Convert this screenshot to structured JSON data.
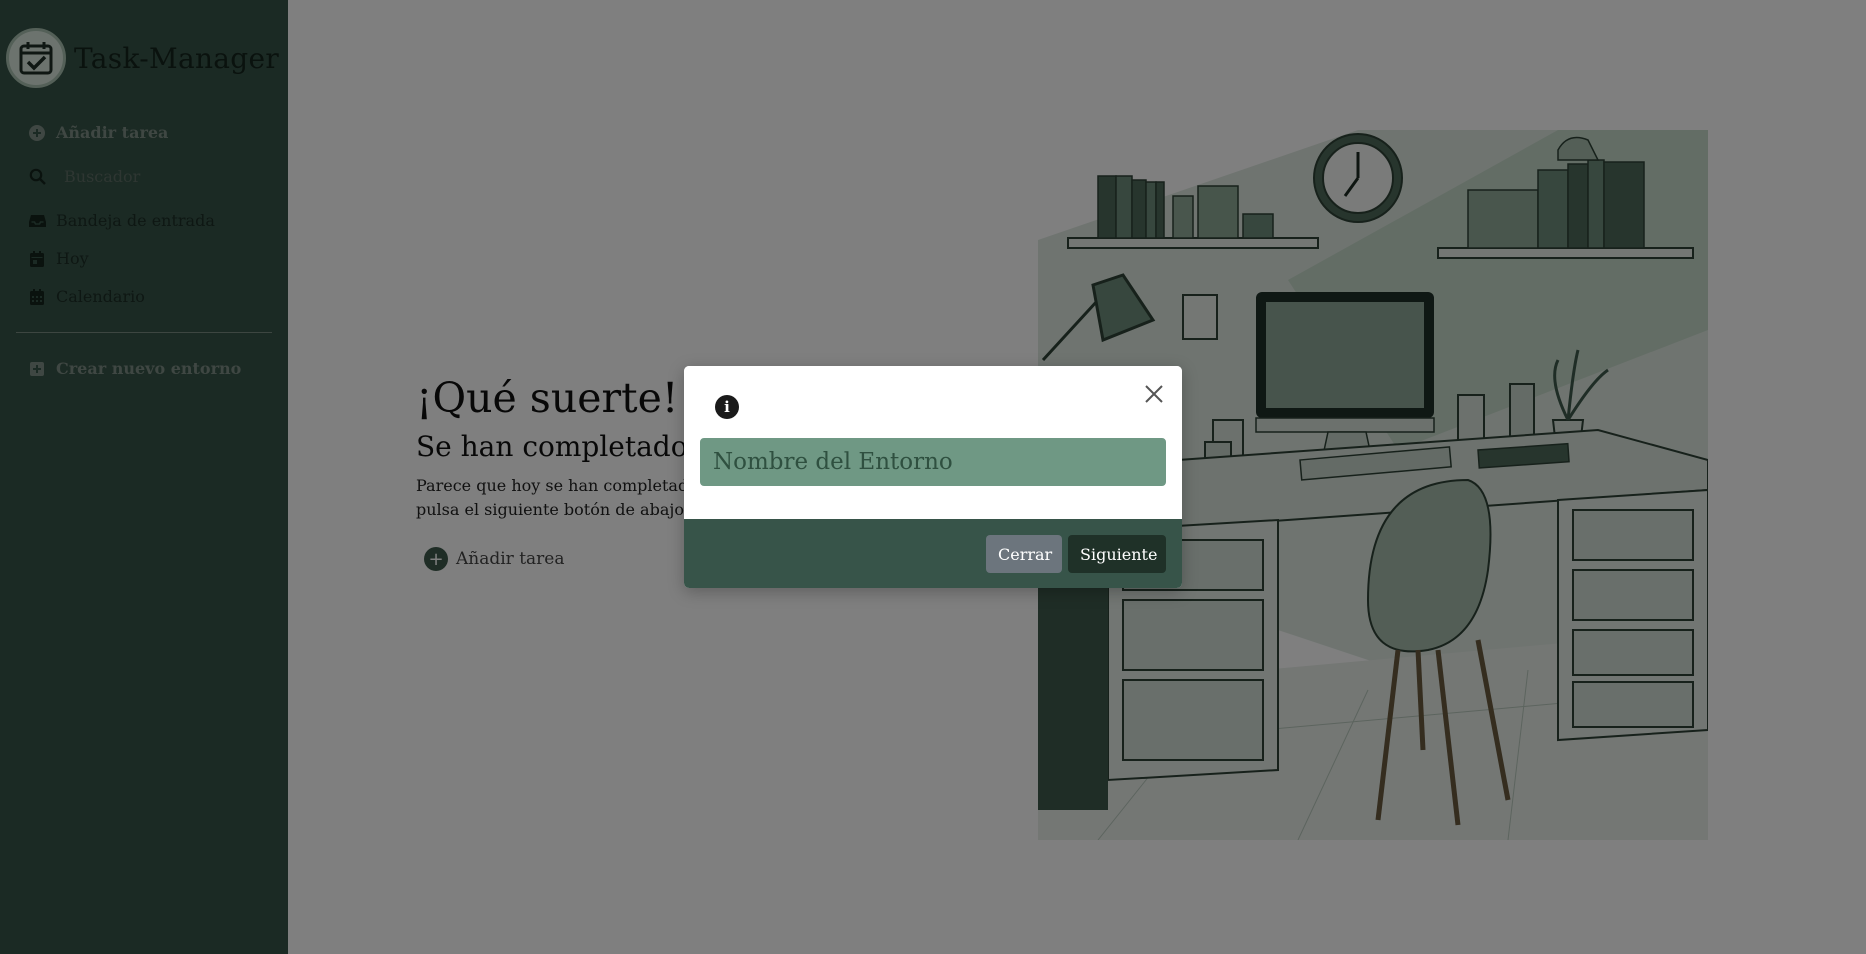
{
  "sidebar": {
    "app_title": "Task-Manager",
    "add_task_label": "Añadir tarea",
    "search_placeholder": "Buscador",
    "items": [
      {
        "label": "Bandeja de entrada",
        "icon": "inbox-icon"
      },
      {
        "label": "Hoy",
        "icon": "calendar-day-icon"
      },
      {
        "label": "Calendario",
        "icon": "calendar-icon"
      }
    ],
    "create_env_label": "Crear nuevo entorno"
  },
  "main": {
    "title": "¡Qué suerte!",
    "subtitle": "Se han completado t",
    "text_line1": "Parece que hoy se han completado",
    "text_line2": "pulsa el siguiente botón de abajo.",
    "add_task_label": "Añadir tarea"
  },
  "modal": {
    "input_placeholder": "Nombre del Entorno",
    "close_button": "Cerrar",
    "next_button": "Siguiente"
  },
  "colors": {
    "sidebar": "#375449",
    "accent": "#6f9884",
    "dark": "#1f3128",
    "secondary_button": "#6c757d"
  }
}
